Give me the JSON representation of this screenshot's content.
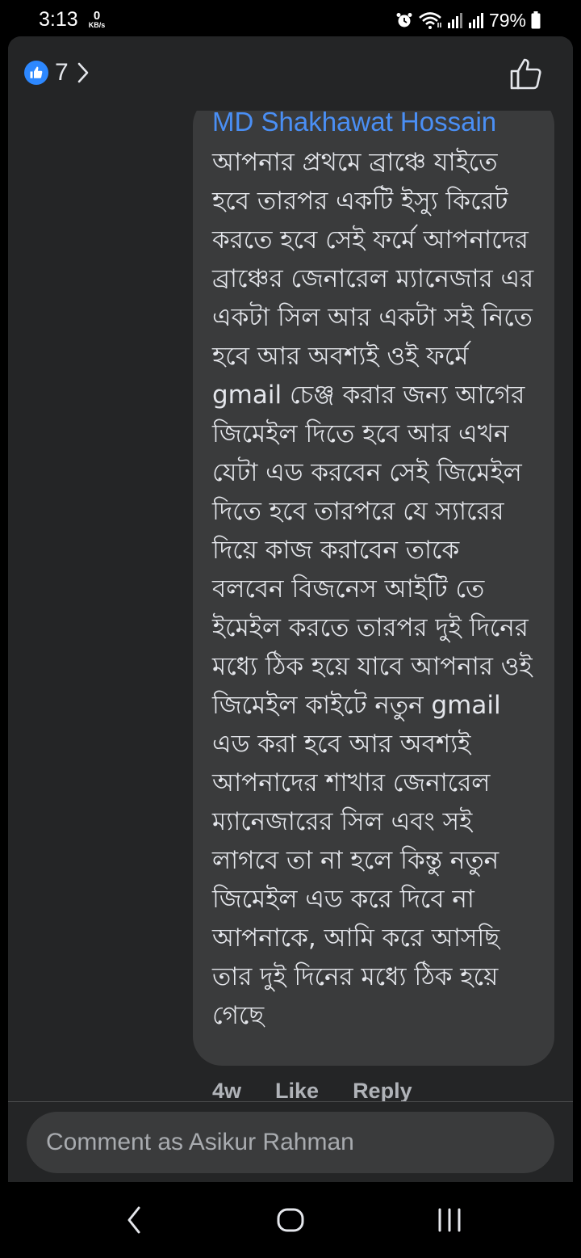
{
  "status_bar": {
    "time": "3:13",
    "net_speed": "0",
    "net_unit": "KB/s",
    "battery": "79%",
    "icons": [
      "alarm-icon",
      "wifi-icon",
      "signal-icon",
      "signal-icon",
      "battery-icon"
    ]
  },
  "header": {
    "reaction_icon": "like-reaction-icon",
    "like_count": "7",
    "chevron_icon": "chevron-right-icon",
    "like_button_icon": "thumbs-up-outline-icon"
  },
  "comment": {
    "author": "MD Shakhawat Hossain",
    "text": "আপনার প্রথমে ব্রাঞ্চে যাইতে হবে তারপর একটি ইস্যু কিরেট করতে হবে সেই ফর্মে আপনাদের ব্রাঞ্চের জেনারেল ম্যানেজার  এর একটা সিল আর একটা সই  নিতে হবে আর অবশ্যই ওই ফর্মে gmail চেঞ্জ করার জন্য আগের জিমেইল দিতে হবে আর এখন যেটা এড করবেন সেই জিমেইল দিতে হবে তারপরে যে স্যারের দিয়ে কাজ করাবেন তাকে বলবেন বিজনেস আইটি তে ইমেইল করতে তারপর দুই দিনের মধ্যে ঠিক হয়ে যাবে আপনার ওই জিমেইল কাইটে নতুন gmail এড করা হবে আর অবশ্যই আপনাদের শাখার জেনারেল ম্যানেজারের সিল এবং সই লাগবে তা না হলে কিন্তু নতুন জিমেইল এড করে দিবে না আপনাকে, আমি করে আসছি তার দুই দিনের মধ্যে ঠিক হয়ে গেছে",
    "age": "4w",
    "like_label": "Like",
    "reply_label": "Reply"
  },
  "composer": {
    "placeholder": "Comment as Asikur Rahman",
    "value": ""
  },
  "nav_bar": {
    "back_icon": "back-icon",
    "home_icon": "home-icon",
    "recents_icon": "recents-icon"
  },
  "colors": {
    "sheet_bg": "#242526",
    "bubble_bg": "#3a3b3c",
    "author_link": "#4a8ff5",
    "reaction_blue": "#2d88ff",
    "text_primary": "#e4e6eb",
    "text_secondary": "#b0b3b8"
  }
}
